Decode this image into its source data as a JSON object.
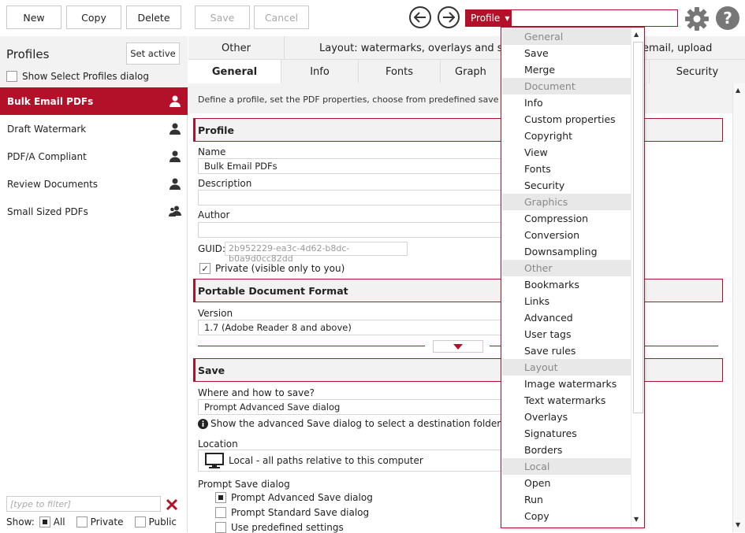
{
  "toolbar": {
    "new": "New",
    "copy": "Copy",
    "delete": "Delete",
    "save": "Save",
    "cancel": "Cancel",
    "profile_dropdown": "Profile",
    "search_value": ""
  },
  "left": {
    "title": "Profiles",
    "set_active": "Set active",
    "show_select_dialog": "Show Select Profiles dialog",
    "profiles": [
      {
        "name": "Bulk Email PDFs",
        "icon": "user-icon",
        "active": true
      },
      {
        "name": "Draft Watermark",
        "icon": "user-icon",
        "active": false
      },
      {
        "name": "PDF/A Compliant",
        "icon": "user-icon",
        "active": false
      },
      {
        "name": "Review Documents",
        "icon": "user-icon",
        "active": false
      },
      {
        "name": "Small Sized PDFs",
        "icon": "users-icon",
        "active": false
      }
    ],
    "filter_placeholder": "[type to filter]",
    "show_label": "Show:",
    "show_all": "All",
    "show_private": "Private",
    "show_public": "Public"
  },
  "tabs": {
    "row1": [
      "Other",
      "Layout: watermarks, overlays and sig",
      "email, upload"
    ],
    "row2": [
      "General",
      "Info",
      "Fonts",
      "Graph",
      "Security"
    ]
  },
  "content": {
    "intro": "Define a profile, set the PDF properties, choose from predefined save pre",
    "profile_section": "Profile",
    "name_label": "Name",
    "name_value": "Bulk Email PDFs",
    "description_label": "Description",
    "author_label": "Author",
    "guid_label": "GUID:",
    "guid_value": "2b952229-ea3c-4d62-b8dc-b0a9d0cc82dd",
    "private_label": "Private (visible only to you)",
    "pdf_section": "Portable Document Format",
    "version_label": "Version",
    "version_value": "1.7 (Adobe Reader 8 and above)",
    "save_section": "Save",
    "where_label": "Where and how to save?",
    "where_value": "Prompt Advanced Save dialog",
    "info_text": "Show the advanced Save dialog to select a destination folder and a n",
    "location_label": "Location",
    "location_value": "Local - all paths relative to this computer",
    "prompt_label": "Prompt Save dialog",
    "prompt_opt1": "Prompt Advanced Save dialog",
    "prompt_opt2": "Prompt Standard Save dialog",
    "prompt_opt3": "Use predefined settings"
  },
  "dropdown": {
    "items": [
      {
        "label": "General",
        "group": true
      },
      {
        "label": "Save",
        "group": false
      },
      {
        "label": "Merge",
        "group": false
      },
      {
        "label": "Document",
        "group": true
      },
      {
        "label": "Info",
        "group": false
      },
      {
        "label": "Custom properties",
        "group": false
      },
      {
        "label": "Copyright",
        "group": false
      },
      {
        "label": "View",
        "group": false
      },
      {
        "label": "Fonts",
        "group": false
      },
      {
        "label": "Security",
        "group": false
      },
      {
        "label": "Graphics",
        "group": true
      },
      {
        "label": "Compression",
        "group": false
      },
      {
        "label": "Conversion",
        "group": false
      },
      {
        "label": "Downsampling",
        "group": false
      },
      {
        "label": "Other",
        "group": true
      },
      {
        "label": "Bookmarks",
        "group": false
      },
      {
        "label": "Links",
        "group": false
      },
      {
        "label": "Advanced",
        "group": false
      },
      {
        "label": "User tags",
        "group": false
      },
      {
        "label": "Save rules",
        "group": false
      },
      {
        "label": "Layout",
        "group": true
      },
      {
        "label": "Image watermarks",
        "group": false
      },
      {
        "label": "Text watermarks",
        "group": false
      },
      {
        "label": "Overlays",
        "group": false
      },
      {
        "label": "Signatures",
        "group": false
      },
      {
        "label": "Borders",
        "group": false
      },
      {
        "label": "Local",
        "group": true
      },
      {
        "label": "Open",
        "group": false
      },
      {
        "label": "Run",
        "group": false
      },
      {
        "label": "Copy",
        "group": false
      }
    ]
  },
  "colors": {
    "accent": "#b3102a",
    "panel": "#f2f2f2",
    "group_bg": "#e8e8e8"
  }
}
